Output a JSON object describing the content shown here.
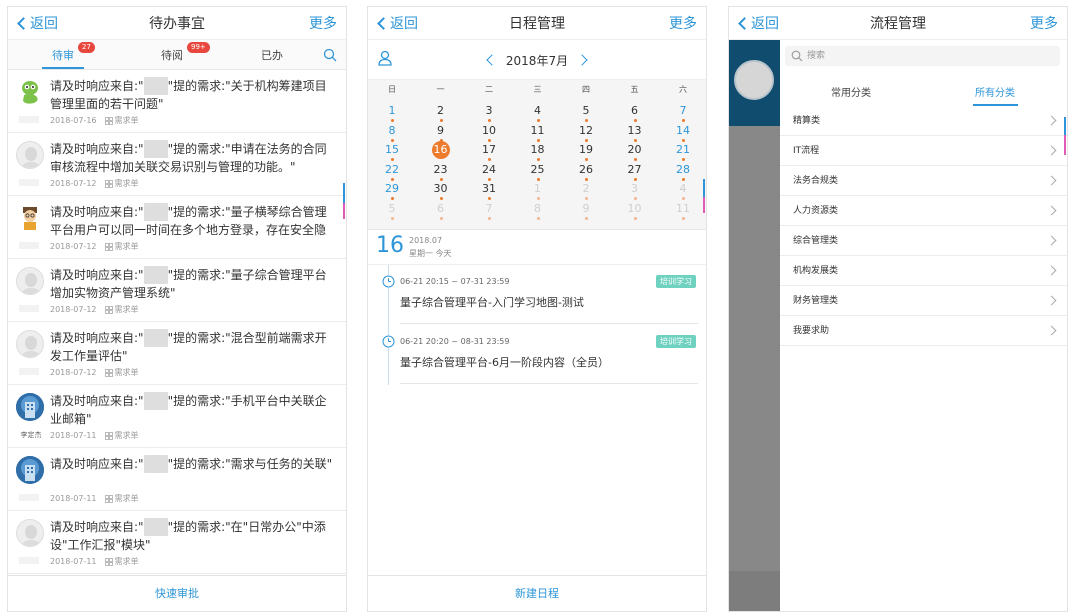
{
  "screen1": {
    "back_label": "返回",
    "title": "待办事宜",
    "more_label": "更多",
    "tabs": [
      {
        "label": "待审",
        "badge": "27"
      },
      {
        "label": "待阅",
        "badge": "99+"
      },
      {
        "label": "已办",
        "badge": ""
      }
    ],
    "items": [
      {
        "prefix": "请及时响应来自:\"",
        "suffix": "\"提的需求:\"关于机构筹建项目管理里面的若干问题\"",
        "date": "2018-07-16",
        "tag": "需求单",
        "avatar": "snake",
        "name": ""
      },
      {
        "prefix": "请及时响应来自:\"",
        "suffix": "\"提的需求:\"申请在法务的合同审核流程中增加关联交易识别与管理的功能。\"",
        "date": "2018-07-12",
        "tag": "需求单",
        "avatar": "grey",
        "name": ""
      },
      {
        "prefix": "请及时响应来自:\"",
        "suffix": "\"提的需求:\"量子横琴综合管理平台用户可以同一时间在多个地方登录，存在安全隐患…",
        "date": "2018-07-12",
        "tag": "需求单",
        "avatar": "cartoon",
        "name": ""
      },
      {
        "prefix": "请及时响应来自:\"",
        "suffix": "\"提的需求:\"量子综合管理平台增加实物资产管理系统\"",
        "date": "2018-07-12",
        "tag": "需求单",
        "avatar": "grey",
        "name": ""
      },
      {
        "prefix": "请及时响应来自:\"",
        "suffix": "\"提的需求:\"混合型前端需求开发工作量评估\"",
        "date": "2018-07-12",
        "tag": "需求单",
        "avatar": "grey",
        "name": ""
      },
      {
        "prefix": "请及时响应来自:\"",
        "suffix": "\"提的需求:\"手机平台中关联企业邮箱\"",
        "date": "2018-07-11",
        "tag": "需求单",
        "avatar": "blue",
        "name": "李定杰"
      },
      {
        "prefix": "请及时响应来自:\"",
        "suffix": "\"提的需求:\"需求与任务的关联\"",
        "date": "2018-07-11",
        "tag": "需求单",
        "avatar": "blue",
        "name": ""
      },
      {
        "prefix": "请及时响应来自:\"",
        "suffix": "\"提的需求:\"在\"日常办公\"中添设\"工作汇报\"模块\"",
        "date": "2018-07-11",
        "tag": "需求单",
        "avatar": "grey",
        "name": ""
      }
    ],
    "footer_label": "快速审批"
  },
  "screen2": {
    "back_label": "返回",
    "title": "日程管理",
    "more_label": "更多",
    "month_label": "2018年7月",
    "weekdays": [
      "日",
      "一",
      "二",
      "三",
      "四",
      "五",
      "六"
    ],
    "weeks": [
      [
        {
          "d": "1",
          "t": "we"
        },
        {
          "d": "2",
          "t": ""
        },
        {
          "d": "3",
          "t": ""
        },
        {
          "d": "4",
          "t": ""
        },
        {
          "d": "5",
          "t": ""
        },
        {
          "d": "6",
          "t": ""
        },
        {
          "d": "7",
          "t": "we"
        }
      ],
      [
        {
          "d": "8",
          "t": "we"
        },
        {
          "d": "9",
          "t": ""
        },
        {
          "d": "10",
          "t": ""
        },
        {
          "d": "11",
          "t": ""
        },
        {
          "d": "12",
          "t": ""
        },
        {
          "d": "13",
          "t": ""
        },
        {
          "d": "14",
          "t": "we"
        }
      ],
      [
        {
          "d": "15",
          "t": "we"
        },
        {
          "d": "16",
          "t": "today"
        },
        {
          "d": "17",
          "t": ""
        },
        {
          "d": "18",
          "t": ""
        },
        {
          "d": "19",
          "t": ""
        },
        {
          "d": "20",
          "t": ""
        },
        {
          "d": "21",
          "t": "we"
        }
      ],
      [
        {
          "d": "22",
          "t": "we"
        },
        {
          "d": "23",
          "t": ""
        },
        {
          "d": "24",
          "t": ""
        },
        {
          "d": "25",
          "t": ""
        },
        {
          "d": "26",
          "t": ""
        },
        {
          "d": "27",
          "t": ""
        },
        {
          "d": "28",
          "t": "we"
        }
      ],
      [
        {
          "d": "29",
          "t": "we"
        },
        {
          "d": "30",
          "t": ""
        },
        {
          "d": "31",
          "t": ""
        },
        {
          "d": "1",
          "t": "out"
        },
        {
          "d": "2",
          "t": "out"
        },
        {
          "d": "3",
          "t": "out"
        },
        {
          "d": "4",
          "t": "out"
        }
      ],
      [
        {
          "d": "5",
          "t": "out"
        },
        {
          "d": "6",
          "t": "out"
        },
        {
          "d": "7",
          "t": "out"
        },
        {
          "d": "8",
          "t": "out"
        },
        {
          "d": "9",
          "t": "out"
        },
        {
          "d": "10",
          "t": "out"
        },
        {
          "d": "11",
          "t": "out"
        }
      ]
    ],
    "selected_day": "16",
    "selected_ym": "2018.07",
    "selected_weekday": "星期一 今天",
    "events": [
      {
        "time": "06-21 20:15 ~ 07-31 23:59",
        "badge": "培训学习",
        "name": "量子综合管理平台-入门学习地图-测试"
      },
      {
        "time": "06-21 20:20 ~ 08-31 23:59",
        "badge": "培训学习",
        "name": "量子综合管理平台-6月一阶段内容（全员）"
      }
    ],
    "footer_label": "新建日程"
  },
  "screen3": {
    "back_label": "返回",
    "title": "流程管理",
    "more_label": "更多",
    "search_placeholder": "搜索",
    "tabs": [
      {
        "label": "常用分类"
      },
      {
        "label": "所有分类"
      }
    ],
    "categories": [
      "精算类",
      "IT流程",
      "法务合规类",
      "人力资源类",
      "综合管理类",
      "机构发展类",
      "财务管理类",
      "我要求助"
    ]
  },
  "colors": {
    "accent": "#2e96d8",
    "today": "#ee7b2c",
    "badge_red": "#e8473d",
    "event_badge": "#6fd1bf"
  }
}
